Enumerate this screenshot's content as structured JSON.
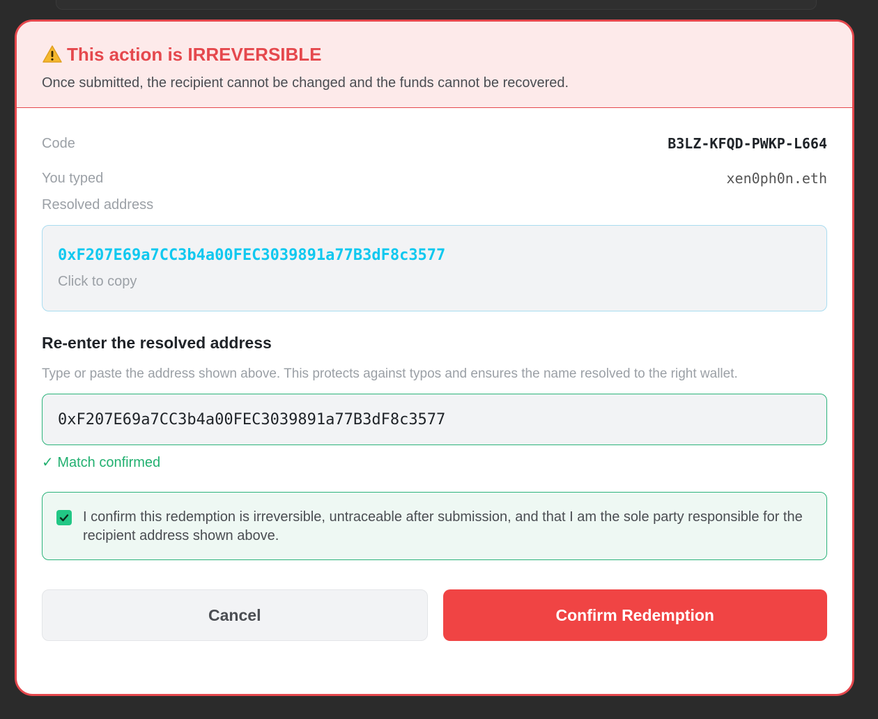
{
  "warning": {
    "title": "This action is IRREVERSIBLE",
    "subtitle": "Once submitted, the recipient cannot be changed and the funds cannot be recovered.",
    "icon": "warning-icon"
  },
  "details": {
    "code_label": "Code",
    "code_value": "B3LZ-KFQD-PWKP-L664",
    "typed_label": "You typed",
    "typed_value": "xen0ph0n.eth",
    "resolved_label": "Resolved address",
    "resolved_address": "0xF207E69a7CC3b4a00FEC3039891a77B3dF8c3577",
    "copy_hint": "Click to copy"
  },
  "reenter": {
    "title": "Re-enter the resolved address",
    "description": "Type or paste the address shown above. This protects against typos and ensures the name resolved to the right wallet.",
    "input_value": "0xF207E69a7CC3b4a00FEC3039891a77B3dF8c3577",
    "match_text": "✓ Match confirmed"
  },
  "confirmation": {
    "checked": true,
    "text": "I confirm this redemption is irreversible, untraceable after submission, and that I am the sole party responsible for the recipient address shown above."
  },
  "actions": {
    "cancel_label": "Cancel",
    "confirm_label": "Confirm Redemption"
  },
  "colors": {
    "danger": "#e5484d",
    "success": "#22b070",
    "address_accent": "#10c8ef"
  }
}
